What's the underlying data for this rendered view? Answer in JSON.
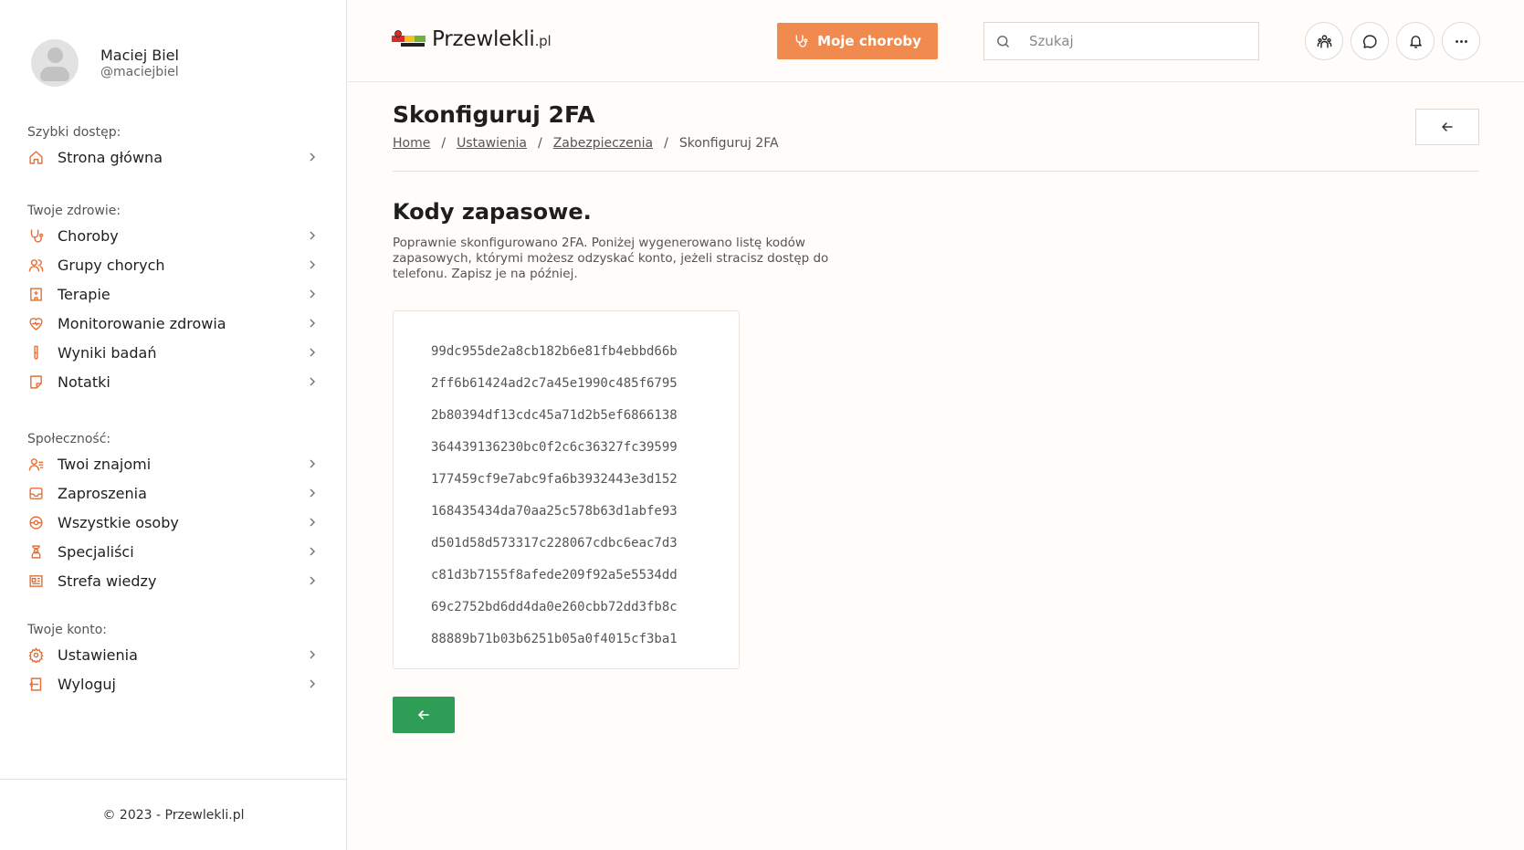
{
  "profile": {
    "name": "Maciej Biel",
    "handle": "@maciejbiel"
  },
  "sidebar": {
    "groups": [
      {
        "title": "Szybki dostęp:",
        "items": [
          {
            "label": "Strona główna",
            "icon": "home-icon"
          }
        ]
      },
      {
        "title": "Twoje zdrowie:",
        "items": [
          {
            "label": "Choroby",
            "icon": "stethoscope-icon"
          },
          {
            "label": "Grupy chorych",
            "icon": "users-icon"
          },
          {
            "label": "Terapie",
            "icon": "hospital-icon"
          },
          {
            "label": "Monitorowanie zdrowia",
            "icon": "heart-pulse-icon"
          },
          {
            "label": "Wyniki badań",
            "icon": "test-tube-icon"
          },
          {
            "label": "Notatki",
            "icon": "note-icon"
          }
        ]
      },
      {
        "title": "Społeczność:",
        "items": [
          {
            "label": "Twoi znajomi",
            "icon": "user-list-icon"
          },
          {
            "label": "Zaproszenia",
            "icon": "inbox-icon"
          },
          {
            "label": "Wszystkie osoby",
            "icon": "globe-icon"
          },
          {
            "label": "Specjaliści",
            "icon": "doctor-icon"
          },
          {
            "label": "Strefa wiedzy",
            "icon": "newspaper-icon"
          }
        ]
      },
      {
        "title": "Twoje konto:",
        "items": [
          {
            "label": "Ustawienia",
            "icon": "gear-icon"
          },
          {
            "label": "Wyloguj",
            "icon": "logout-icon"
          }
        ]
      }
    ],
    "footer": "© 2023 - Przewlekli.pl"
  },
  "header": {
    "logo_text": "Przewlekli",
    "logo_suffix": ".pl",
    "primary_button": "Moje choroby",
    "search_placeholder": "Szukaj"
  },
  "main": {
    "page_title": "Skonfiguruj 2FA",
    "breadcrumb": [
      "Home",
      "Ustawienia",
      "Zabezpieczenia",
      "Skonfiguruj 2FA"
    ],
    "section_title": "Kody zapasowe.",
    "section_desc": "Poprawnie skonfigurowano 2FA. Poniżej wygenerowano listę kodów zapasowych, którymi możesz odzyskać konto, jeżeli stracisz dostęp do telefonu. Zapisz je na później.",
    "codes": [
      "99dc955de2a8cb182b6e81fb4ebbd66b",
      "2ff6b61424ad2c7a45e1990c485f6795",
      "2b80394df13cdc45a71d2b5ef6866138",
      "364439136230bc0f2c6c36327fc39599",
      "177459cf9e7abc9fa6b3932443e3d152",
      "168435434da70aa25c578b63d1abfe93",
      "d501d58d573317c228067cdbc6eac7d3",
      "c81d3b7155f8afede209f92a5e5534dd",
      "69c2752bd6dd4da0e260cbb72dd3fb8c",
      "88889b71b03b6251b05a0f4015cf3ba1"
    ]
  },
  "colors": {
    "accent": "#f08a4f",
    "icon": "#e2703a",
    "success": "#2e9e57"
  }
}
